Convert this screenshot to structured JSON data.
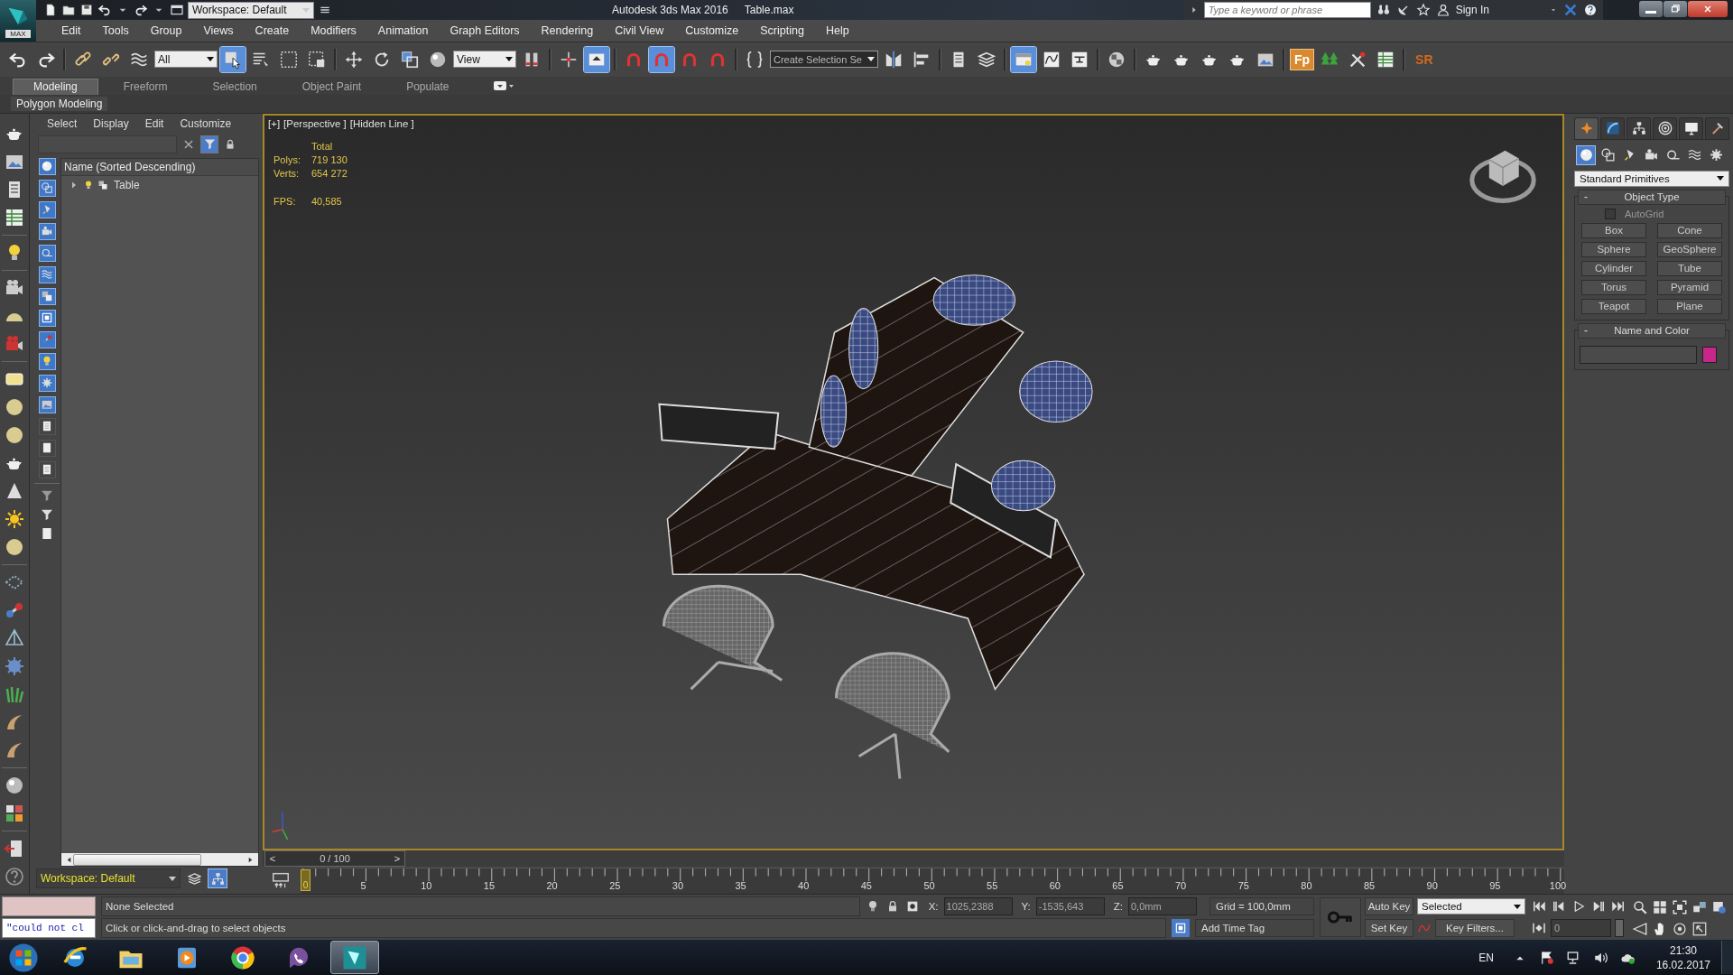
{
  "title_bar": {
    "logo_label": "MAX",
    "workspace": "Workspace: Default",
    "app_title": "Autodesk 3ds Max 2016",
    "file_name": "Table.max",
    "search": {
      "placeholder": "Type a keyword or phrase"
    },
    "sign_in": "Sign In"
  },
  "menu": [
    "Edit",
    "Tools",
    "Group",
    "Views",
    "Create",
    "Modifiers",
    "Animation",
    "Graph Editors",
    "Rendering",
    "Civil View",
    "Customize",
    "Scripting",
    "Help"
  ],
  "main_toolbar": [
    {
      "kind": "undo",
      "active": false
    },
    {
      "kind": "redo",
      "active": false
    },
    {
      "kind": "sep"
    },
    {
      "kind": "link",
      "active": false
    },
    {
      "kind": "unlink",
      "active": false
    },
    {
      "kind": "bind",
      "active": false
    },
    {
      "kind": "dropdown",
      "value": "All"
    },
    {
      "kind": "select",
      "active": true
    },
    {
      "kind": "selname",
      "active": false
    },
    {
      "kind": "rect",
      "active": false
    },
    {
      "kind": "window",
      "active": false
    },
    {
      "kind": "sep"
    },
    {
      "kind": "move",
      "active": false
    },
    {
      "kind": "rotate",
      "active": false
    },
    {
      "kind": "scale",
      "active": false
    },
    {
      "kind": "sphere",
      "active": false
    },
    {
      "kind": "dropdown",
      "value": "View"
    },
    {
      "kind": "pivot",
      "active": false
    },
    {
      "kind": "sep"
    },
    {
      "kind": "manip",
      "active": false
    },
    {
      "kind": "keyboard",
      "active": true
    },
    {
      "kind": "sep"
    },
    {
      "kind": "snap",
      "active": false
    },
    {
      "kind": "snap",
      "active": true
    },
    {
      "kind": "snap",
      "active": false
    },
    {
      "kind": "snap",
      "active": false
    },
    {
      "kind": "sep"
    },
    {
      "kind": "braces",
      "active": false
    },
    {
      "kind": "field",
      "value": "Create Selection Se"
    },
    {
      "kind": "mirror",
      "active": false
    },
    {
      "kind": "align",
      "active": false
    },
    {
      "kind": "sep"
    },
    {
      "kind": "list",
      "active": false
    },
    {
      "kind": "layers",
      "active": false
    },
    {
      "kind": "sep"
    },
    {
      "kind": "explorer",
      "active": true
    },
    {
      "kind": "curve",
      "active": false
    },
    {
      "kind": "dope",
      "active": false
    },
    {
      "kind": "sep"
    },
    {
      "kind": "material",
      "active": false
    },
    {
      "kind": "sep"
    },
    {
      "kind": "teapot",
      "active": false
    },
    {
      "kind": "teapot",
      "active": false
    },
    {
      "kind": "teapot",
      "active": false
    },
    {
      "kind": "teapot",
      "active": false
    },
    {
      "kind": "frame",
      "active": false
    },
    {
      "kind": "sep"
    },
    {
      "kind": "badge",
      "text": "Fp"
    },
    {
      "kind": "tree",
      "active": false
    },
    {
      "kind": "tools",
      "active": false
    },
    {
      "kind": "sheet",
      "active": false
    },
    {
      "kind": "sep"
    },
    {
      "kind": "label",
      "text": "SR"
    }
  ],
  "ribbon": {
    "tabs": [
      {
        "label": "Modeling",
        "selected": true
      },
      {
        "label": "Freeform",
        "selected": false
      },
      {
        "label": "Selection",
        "selected": false
      },
      {
        "label": "Object Paint",
        "selected": false
      },
      {
        "label": "Populate",
        "selected": false
      }
    ],
    "panel": "Polygon Modeling"
  },
  "scene_explorer": {
    "menu": [
      "Select",
      "Display",
      "Edit",
      "Customize"
    ],
    "filter_enabled": true,
    "filters": [
      {
        "on": true
      },
      {
        "on": true
      },
      {
        "on": true
      },
      {
        "on": true
      },
      {
        "on": true
      },
      {
        "on": true
      },
      {
        "on": true
      },
      {
        "on": true
      },
      {
        "on": true
      },
      {
        "on": true
      },
      {
        "on": true
      },
      {
        "on": true
      },
      {
        "on": false
      },
      {
        "on": false
      },
      {
        "on": false
      }
    ],
    "column": "Name (Sorted Descending)",
    "rows": [
      {
        "name": "Table",
        "expanded": false
      }
    ],
    "workspace": "Workspace: Default",
    "modes": [
      {
        "kind": "layers",
        "selected": false
      },
      {
        "kind": "hierarchy",
        "selected": true
      }
    ]
  },
  "viewport": {
    "labels": [
      "[+]",
      "[Perspective ]",
      "[Hidden Line ]"
    ],
    "stats": {
      "heading": "Total",
      "rows": [
        {
          "label": "Polys:",
          "value": "719 130"
        },
        {
          "label": "Verts:",
          "value": "654 272"
        },
        {
          "label": "FPS:",
          "value": "40,585"
        }
      ]
    }
  },
  "time_slider": {
    "prev": "<",
    "position": "0 / 100",
    "next": ">",
    "level": 0
  },
  "track_labels": [
    "0",
    "5",
    "10",
    "15",
    "20",
    "25",
    "30",
    "35",
    "40",
    "45",
    "50",
    "55",
    "60",
    "65",
    "70",
    "75",
    "80",
    "85",
    "90",
    "95",
    "100"
  ],
  "command_panel": {
    "tabs": [
      {
        "kind": "create",
        "selected": true
      },
      {
        "kind": "modify",
        "selected": false
      },
      {
        "kind": "hierarchy",
        "selected": false
      },
      {
        "kind": "motion",
        "selected": false
      },
      {
        "kind": "display",
        "selected": false
      },
      {
        "kind": "utilities",
        "selected": false
      }
    ],
    "categories": [
      {
        "kind": "geometry",
        "selected": true
      },
      {
        "kind": "shapes",
        "selected": false
      },
      {
        "kind": "lights",
        "selected": false
      },
      {
        "kind": "cameras",
        "selected": false
      },
      {
        "kind": "helpers",
        "selected": false
      },
      {
        "kind": "spacewarps",
        "selected": false
      },
      {
        "kind": "systems",
        "selected": false
      }
    ],
    "type": "Standard Primitives",
    "object_type": {
      "collapse": "-",
      "title": "Object Type",
      "autogrid": {
        "label": "AutoGrid",
        "checked": false
      },
      "buttons": [
        "Box",
        "Cone",
        "Sphere",
        "GeoSphere",
        "Cylinder",
        "Tube",
        "Torus",
        "Pyramid",
        "Teapot",
        "Plane"
      ]
    },
    "name_color": {
      "collapse": "-",
      "title": "Name and Color"
    }
  },
  "status": {
    "listener": "\"could not cl",
    "prompt": "None Selected",
    "hint": "Click or click-and-drag to select objects",
    "coords": [
      {
        "label": "X:",
        "value": "1025,2388"
      },
      {
        "label": "Y:",
        "value": "-1535,643"
      },
      {
        "label": "Z:",
        "value": "0,0mm"
      }
    ],
    "grid": "Grid = 100,0mm",
    "add_time_tag": "Add Time Tag",
    "auto_key": "Auto Key",
    "key_mode": "Selected",
    "set_key": "Set Key",
    "key_filters": "Key Filters...",
    "frame": "0"
  },
  "taskbar": {
    "apps": [
      {
        "kind": "ie",
        "selected": false
      },
      {
        "kind": "explorer",
        "selected": false
      },
      {
        "kind": "media",
        "selected": false
      },
      {
        "kind": "chrome",
        "selected": false
      },
      {
        "kind": "viber",
        "selected": false
      },
      {
        "kind": "max",
        "selected": true
      }
    ],
    "language": "EN",
    "time": "21:30",
    "date": "16.02.2017"
  }
}
